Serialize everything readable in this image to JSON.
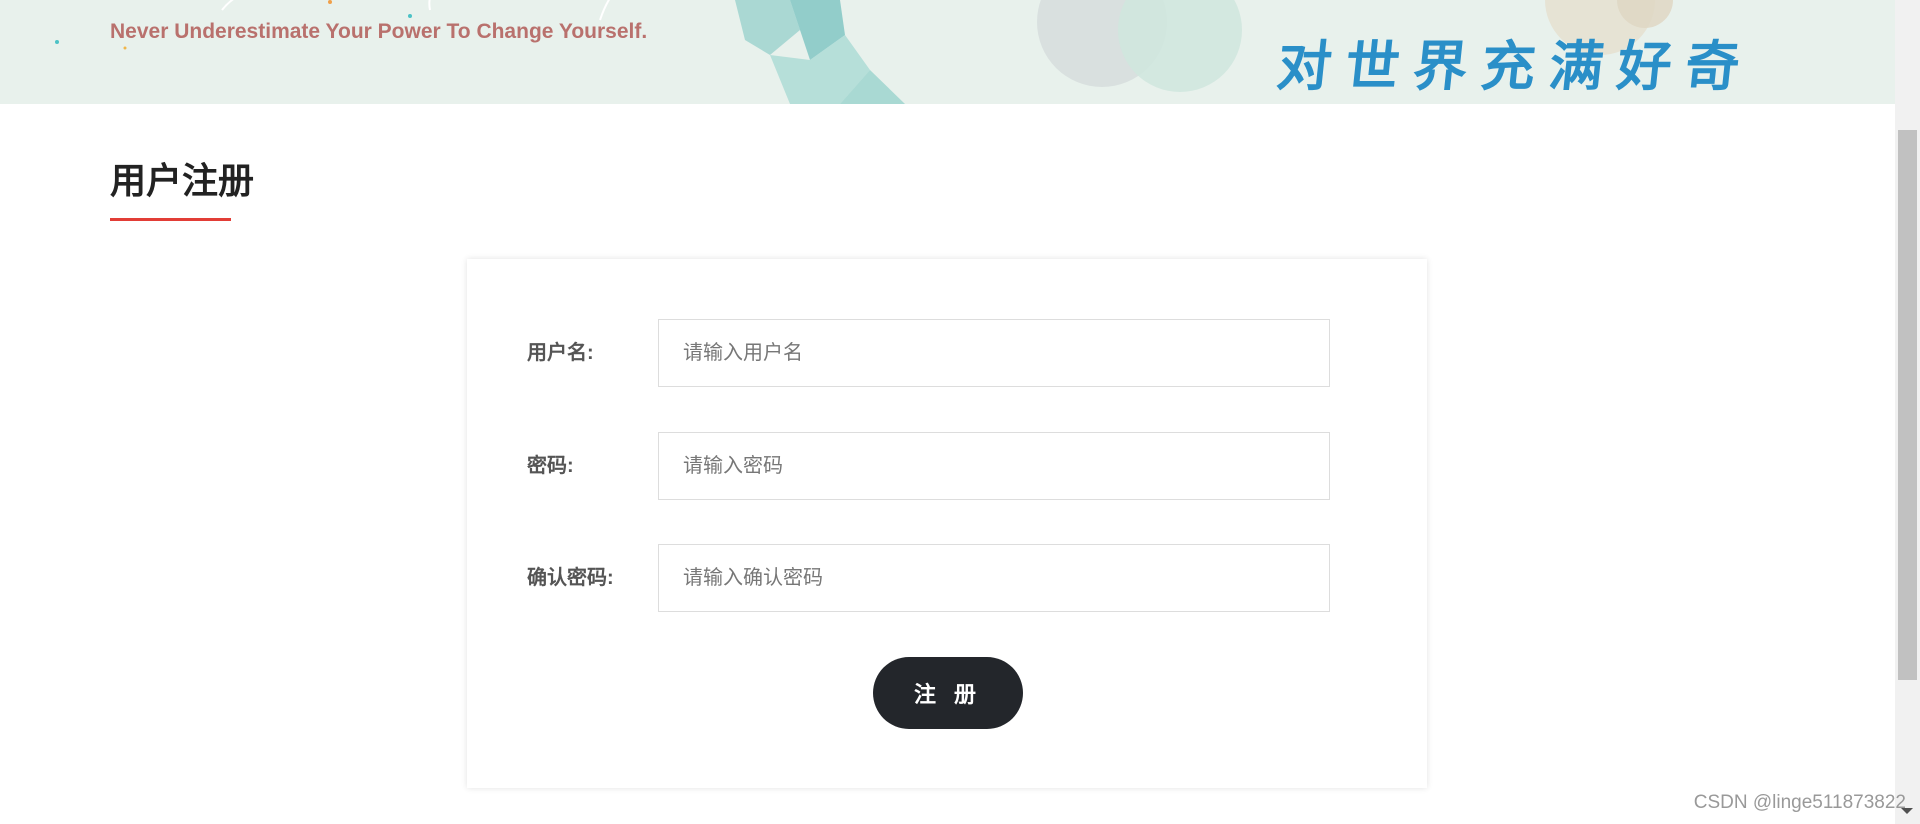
{
  "banner": {
    "tagline": "Never Underestimate Your Power To Change Yourself.",
    "slogan": "对世界充满好奇"
  },
  "section": {
    "title": "用户注册"
  },
  "form": {
    "username_label": "用户名:",
    "username_placeholder": "请输入用户名",
    "password_label": "密码:",
    "password_placeholder": "请输入密码",
    "confirm_label": "确认密码:",
    "confirm_placeholder": "请输入确认密码",
    "submit_label": "注 册"
  },
  "watermark": "CSDN @linge511873822",
  "colors": {
    "banner_bg": "#e8f1ec",
    "tagline": "#b9716d",
    "slogan": "#2a8fc8",
    "accent_underline": "#e23d36",
    "button_bg": "#23262b"
  }
}
